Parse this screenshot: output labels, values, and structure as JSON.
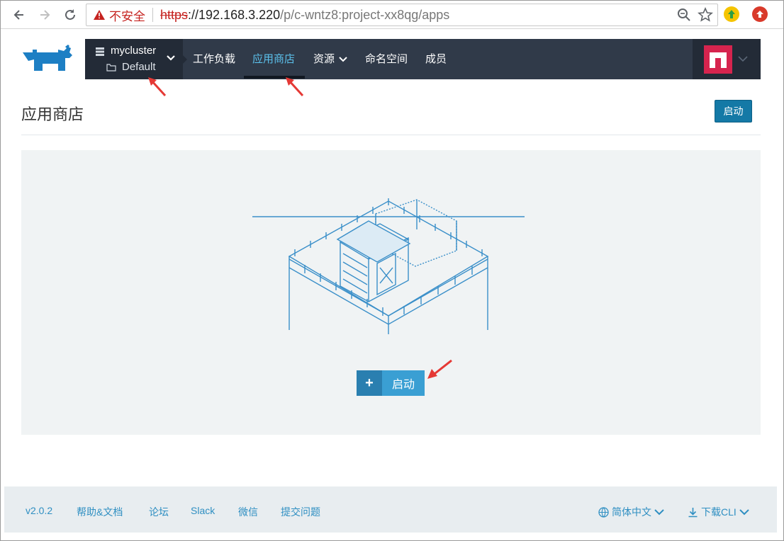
{
  "browser": {
    "security_label": "不安全",
    "url_scheme": "https",
    "url_host": "://192.168.3.220",
    "url_path": "/p/c-wntz8:project-xx8qg/apps"
  },
  "header": {
    "cluster_name": "mycluster",
    "project_name": "Default",
    "nav": [
      {
        "label": "工作负载"
      },
      {
        "label": "应用商店"
      },
      {
        "label": "资源"
      },
      {
        "label": "命名空间"
      },
      {
        "label": "成员"
      }
    ],
    "active_tab": "应用商店"
  },
  "page": {
    "title": "应用商店",
    "launch_button": "启动",
    "empty_launch_button": "启动",
    "empty_launch_icon": "+"
  },
  "footer": {
    "version": "v2.0.2",
    "links": [
      "帮助&文档",
      "论坛",
      "Slack",
      "微信",
      "提交问题"
    ],
    "language": "简体中文",
    "download": "下载CLI"
  },
  "colors": {
    "nav_bg": "#303a49",
    "accent": "#1479a6",
    "active_tab": "#5bc0eb",
    "annotation_arrow": "#e53935"
  }
}
